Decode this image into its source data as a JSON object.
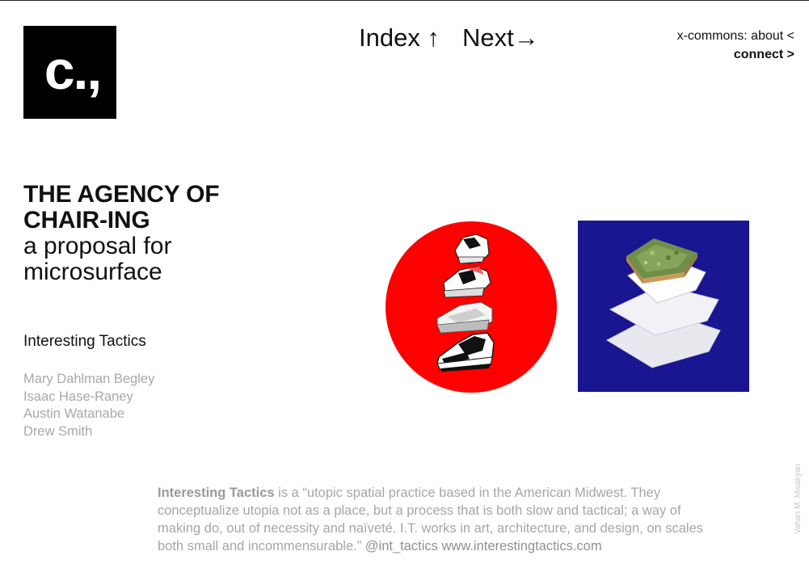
{
  "logo": {
    "text": "c.,"
  },
  "nav": {
    "index_label": "Index ↑",
    "next_label": "Next→"
  },
  "topmenu": {
    "line1": "x-commons: about <",
    "line2": "connect >"
  },
  "title": {
    "line1": "THE AGENCY OF",
    "line2": "CHAIR-ING",
    "line3": "a proposal for",
    "line4": "microsurface"
  },
  "studio": "Interesting Tactics",
  "people": [
    "Mary Dahlman Begley",
    "Isaac Hase-Raney",
    "Austin Watanabe",
    "Drew Smith"
  ],
  "credit": "Vahan M. Misakyan",
  "description": {
    "lead": "Interesting Tactics",
    "body": " is a “utopic spatial practice based in the American Midwest. They conceptualize utopia not as a place, but a process that is both slow and tactical; a way of making do, out of necessity and naïveté. I.T. works in art, architecture, and design, on scales both small and incommensurable.” ",
    "handle": "@int_tactics",
    "url": "www.interestingtactics.com"
  },
  "colors": {
    "circle": "#ff0000",
    "square": "#1a1591",
    "text": "#111111",
    "muted": "#a8a8a8"
  },
  "icons": [
    "sneaker-stack-artwork",
    "layered-planes-artwork"
  ]
}
